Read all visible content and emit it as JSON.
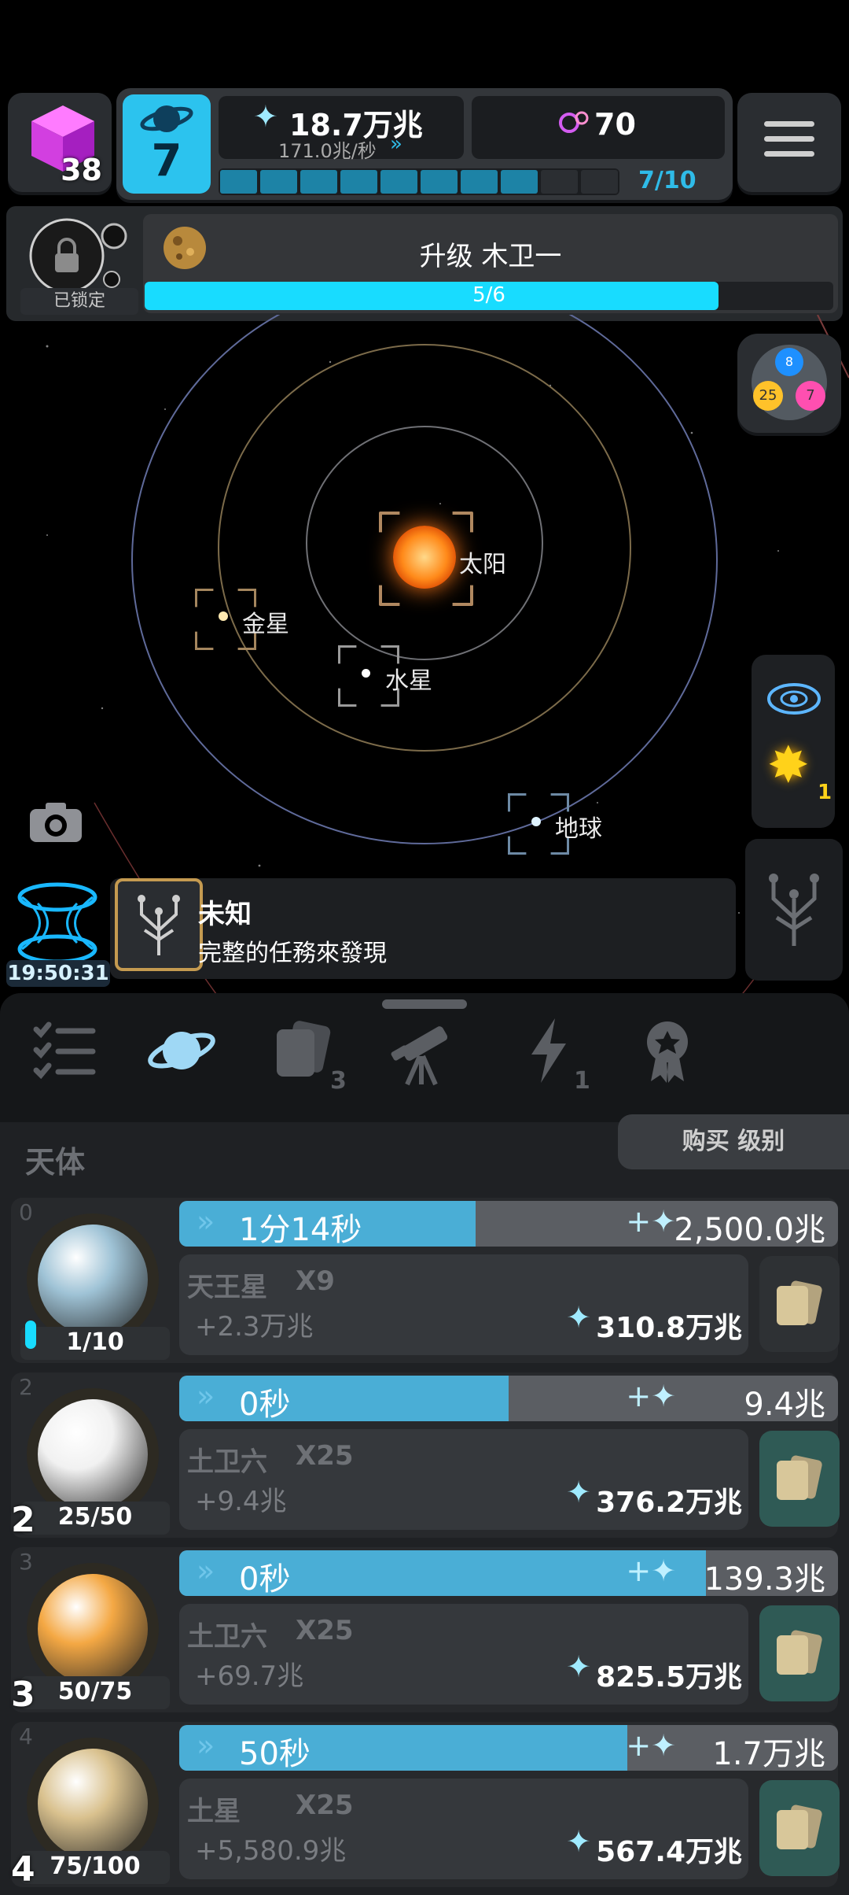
{
  "top": {
    "cube_count": "38",
    "level": "7",
    "currency": "18.7万兆",
    "rate": "171.0兆/秒",
    "orbs": "70",
    "progress_text": "7/10",
    "progress": 0.8
  },
  "upgrade": {
    "locked_label": "已锁定",
    "title": "升级 木卫一",
    "progress_text": "5/6",
    "progress": 0.8333
  },
  "sim": {
    "cluster_numbers": [
      "8",
      "25",
      "7"
    ],
    "sun_label": "太阳",
    "venus_label": "金星",
    "mercury_label": "水星",
    "earth_label": "地球",
    "star_count": "1"
  },
  "quest": {
    "timer": "19:50:31",
    "title": "未知",
    "desc": "完整的任務來發現"
  },
  "tabs": {
    "cards_badge": "3",
    "energy_badge": "1"
  },
  "list": {
    "header": "天体",
    "buy_button": "购买 级别",
    "rows": [
      {
        "index": "0",
        "badge": "",
        "count": "1/10",
        "time": "1分14秒",
        "reward": "2,500.0兆",
        "name": "天王星",
        "mult": "X9",
        "gain": "+2.3万兆",
        "cost": "310.8万兆",
        "progress": 0.45,
        "count_progress": 0.1,
        "color": "#9fc3d6"
      },
      {
        "index": "2",
        "badge": "2",
        "count": "25/50",
        "time": "0秒",
        "reward": "9.4兆",
        "name": "土卫六",
        "mult": "X25",
        "gain": "+9.4兆",
        "cost": "376.2万兆",
        "progress": 0.5,
        "count_progress": 0.5,
        "color": "#f1f1f1"
      },
      {
        "index": "3",
        "badge": "3",
        "count": "50/75",
        "time": "0秒",
        "reward": "139.3兆",
        "name": "土卫六",
        "mult": "X25",
        "gain": "+69.7兆",
        "cost": "825.5万兆",
        "progress": 0.8,
        "count_progress": 0.667,
        "color": "#f4a844"
      },
      {
        "index": "4",
        "badge": "4",
        "count": "75/100",
        "time": "50秒",
        "reward": "1.7万兆",
        "name": "土星",
        "mult": "X25",
        "gain": "+5,580.9兆",
        "cost": "567.4万兆",
        "progress": 0.68,
        "count_progress": 0.75,
        "color": "#d9c18e"
      }
    ]
  }
}
